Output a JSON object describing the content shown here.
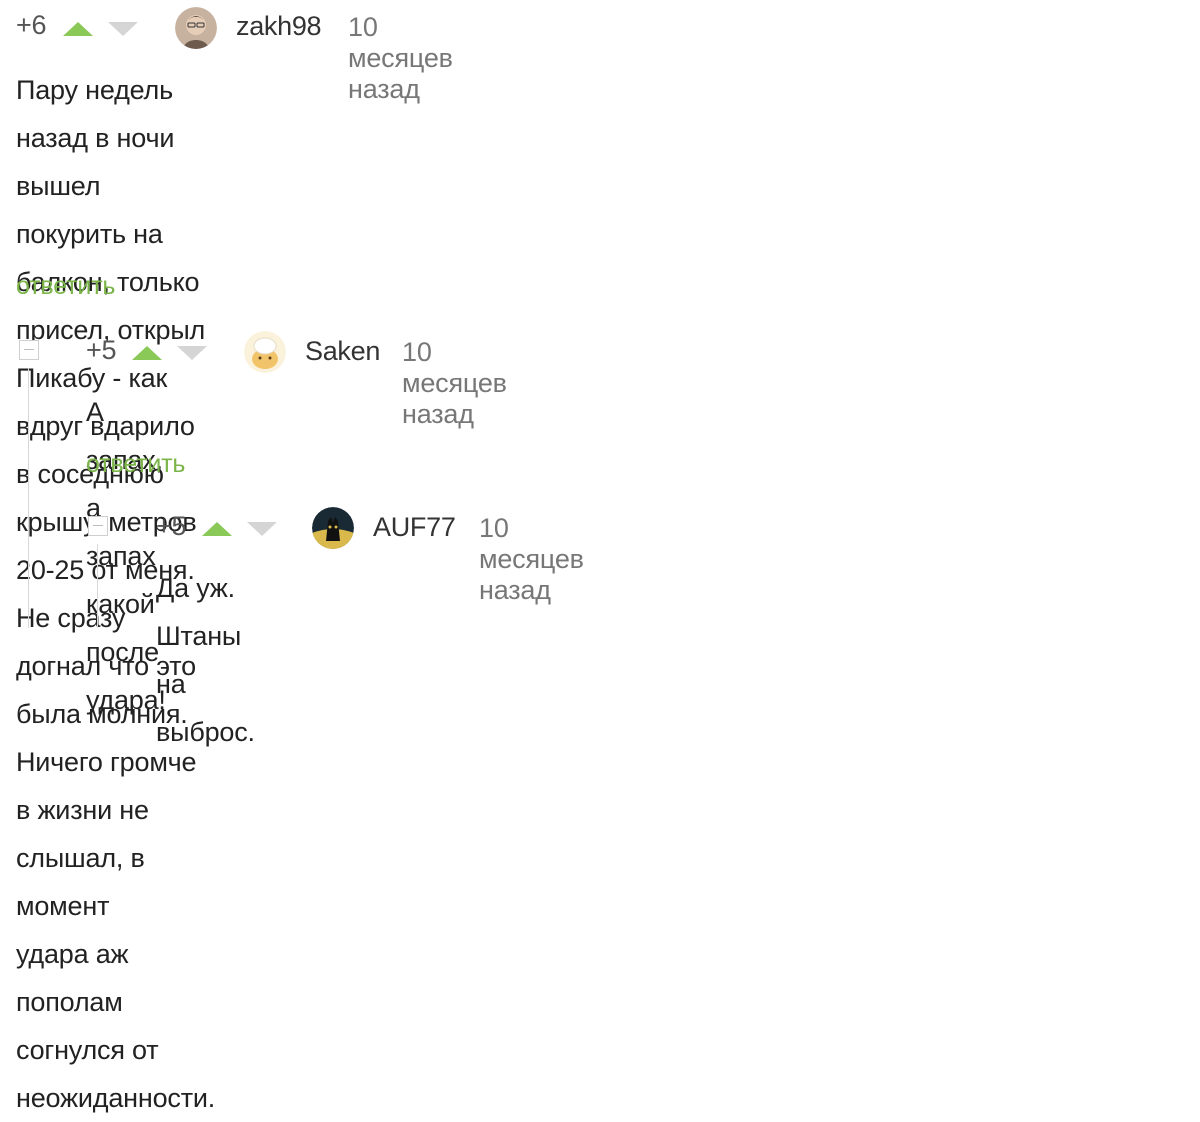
{
  "comments": [
    {
      "rating": "+6",
      "username": "zakh98",
      "time": "10 месяцев назад",
      "lines": [
        "Пару недель назад в ночи вышел покурить на балкон, только присел, открыл",
        "Пикабу - как вдруг вдарило в соседнюю крышу, метров 20-25 от меня. Не сразу",
        "догнал что это была молния. Ничего громче в жизни не слышал, в момент",
        "удара аж пополам согнулся от неожиданности."
      ],
      "reply_label": "ответить"
    },
    {
      "rating": "+5",
      "username": "Saken",
      "time": "10 месяцев назад",
      "lines": [
        "А запах, а запах какой после удара!"
      ],
      "reply_label": "ответить"
    },
    {
      "rating": "+5",
      "username": "AUF77",
      "time": "10 месяцев назад",
      "lines": [
        "Да уж. Штаны на выброс."
      ]
    }
  ],
  "colors": {
    "vote_up": "#8ac858",
    "vote_down": "#d5d5d5",
    "reply_link": "#7bb54a",
    "thread_line": "#d8d8d8"
  },
  "icons": {
    "vote_up": "vote-up-icon",
    "vote_down": "vote-down-icon",
    "collapse": "collapse-icon"
  }
}
